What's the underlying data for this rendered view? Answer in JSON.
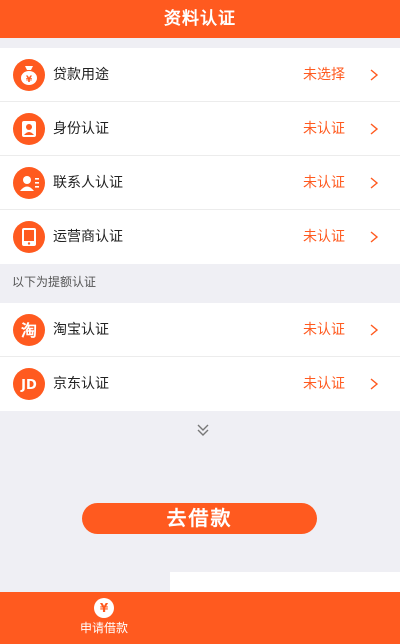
{
  "header": {
    "title": "资料认证"
  },
  "required_items": [
    {
      "icon": "money-bag-icon",
      "label": "贷款用途",
      "status": "未选择"
    },
    {
      "icon": "person-id-icon",
      "label": "身份认证",
      "status": "未认证"
    },
    {
      "icon": "contacts-icon",
      "label": "联系人认证",
      "status": "未认证"
    },
    {
      "icon": "mobile-phone-icon",
      "label": "运营商认证",
      "status": "未认证"
    }
  ],
  "limit_section": {
    "title": "以下为提额认证"
  },
  "limit_items": [
    {
      "icon": "taobao-logo-icon",
      "icon_text": "淘",
      "label": "淘宝认证",
      "status": "未认证"
    },
    {
      "icon": "jd-logo-icon",
      "icon_text": "JD",
      "label": "京东认证",
      "status": "未认证"
    }
  ],
  "primary_action": {
    "label": "去借款"
  },
  "tabbar": {
    "items": [
      {
        "icon": "yuan-circle-icon",
        "icon_text": "¥",
        "label": "申请借款"
      }
    ]
  },
  "colors": {
    "accent": "#ff5a1f",
    "background": "#efeff4"
  }
}
